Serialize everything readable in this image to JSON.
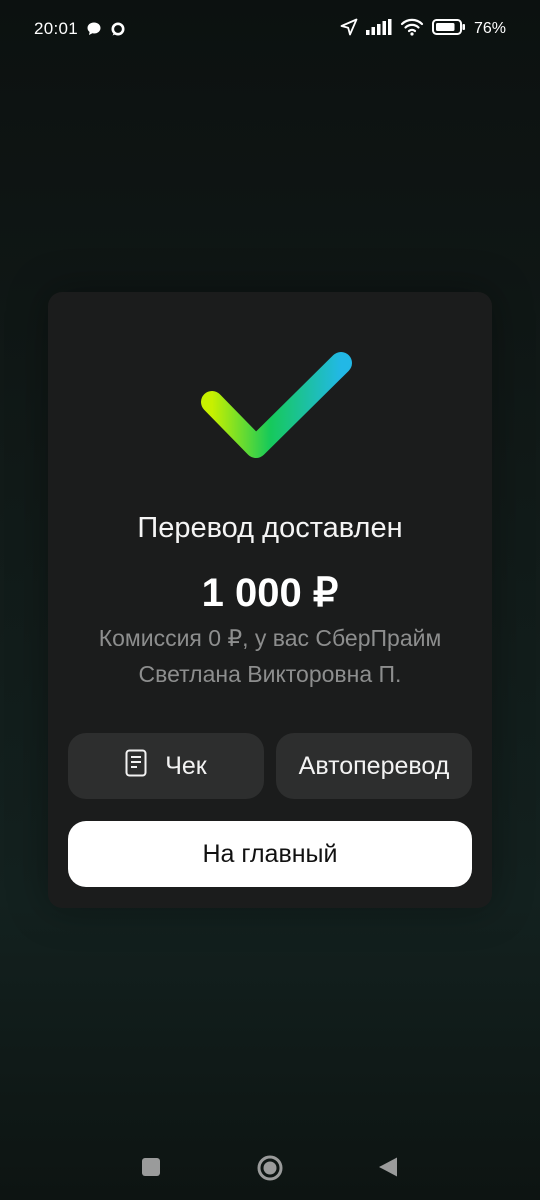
{
  "status_bar": {
    "time": "20:01",
    "battery": "76%",
    "icons": [
      "chat-bubble-icon",
      "message-ring-icon",
      "location-arrow-icon",
      "signal-icon",
      "wifi-icon",
      "battery-icon"
    ]
  },
  "dialog": {
    "title": "Перевод доставлен",
    "amount": "1 000 ₽",
    "commission": "Комиссия 0 ₽, у вас СберПрайм",
    "recipient": "Светлана Викторовна П.",
    "receipt_button": "Чек",
    "autotransfer_button": "Автоперевод",
    "home_button": "На главный",
    "colors": {
      "check_gradient_start": "#c7f000",
      "check_gradient_mid": "#16c95a",
      "check_gradient_end": "#22b8e6",
      "dialog_bg": "#1b1c1c",
      "secondary_button_bg": "#2d2e2e",
      "primary_button_bg": "#ffffff"
    }
  },
  "navbar": {
    "icons": [
      "recents-square-icon",
      "home-circle-icon",
      "back-triangle-icon"
    ]
  }
}
